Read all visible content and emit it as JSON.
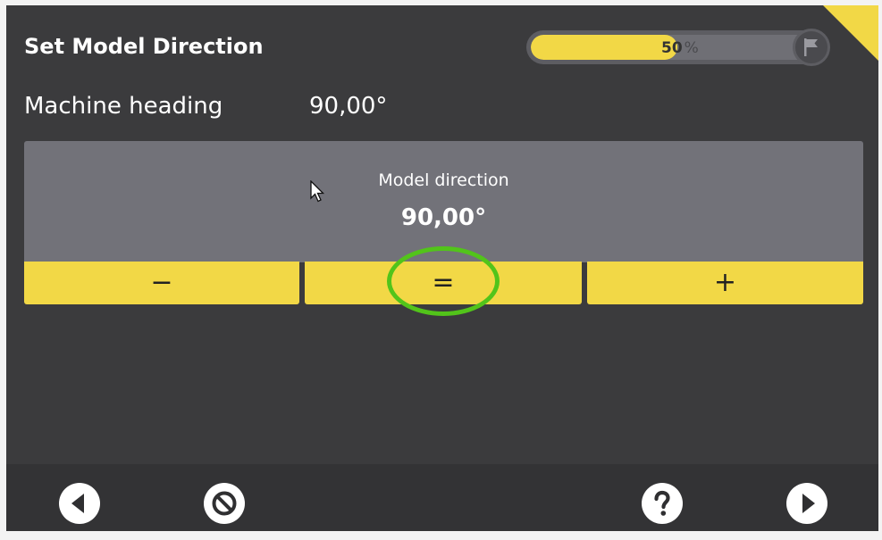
{
  "header": {
    "title": "Set Model Direction",
    "progress": {
      "value_text": "50",
      "unit": "%",
      "fraction": 0.5
    },
    "flag_icon": "flag-icon"
  },
  "machine_heading": {
    "label": "Machine heading",
    "value": "90,00°"
  },
  "model_direction": {
    "label": "Model direction",
    "value": "90,00°"
  },
  "controls": {
    "decrease_label": "−",
    "equal_label": "=",
    "increase_label": "+"
  },
  "footer": {
    "back_icon": "back-arrow-icon",
    "cancel_icon": "cancel-icon",
    "help_icon": "help-icon",
    "next_icon": "next-arrow-icon"
  },
  "colors": {
    "background": "#3b3b3d",
    "accent": "#f2d846",
    "panel": "#727279",
    "highlight": "#52c41a"
  }
}
